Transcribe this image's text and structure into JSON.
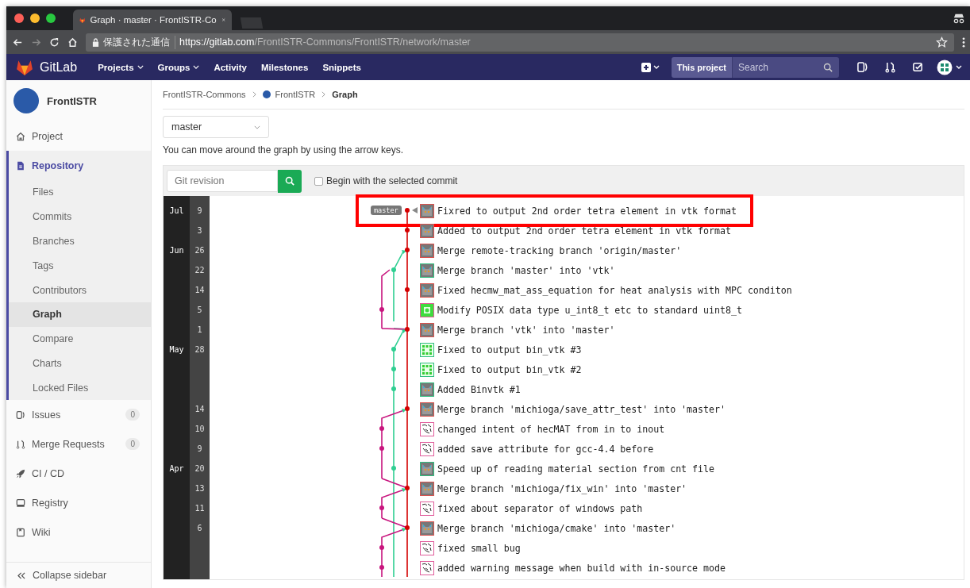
{
  "browser": {
    "tab_title": "Graph · master · FrontISTR-Co",
    "security_label": "保護された通信",
    "url_host": "https://gitlab.com",
    "url_path": "/FrontISTR-Commons/FrontISTR/network/master"
  },
  "nav": {
    "brand": "GitLab",
    "items": [
      {
        "label": "Projects",
        "dropdown": true
      },
      {
        "label": "Groups",
        "dropdown": true
      },
      {
        "label": "Activity",
        "dropdown": false
      },
      {
        "label": "Milestones",
        "dropdown": false
      },
      {
        "label": "Snippets",
        "dropdown": false
      }
    ],
    "scope_label": "This project",
    "search_placeholder": "Search"
  },
  "sidebar": {
    "project_name": "FrontISTR",
    "items": [
      {
        "label": "Project",
        "selected": false
      },
      {
        "label": "Repository",
        "selected": true,
        "children": [
          {
            "label": "Files",
            "selected": false
          },
          {
            "label": "Commits",
            "selected": false
          },
          {
            "label": "Branches",
            "selected": false
          },
          {
            "label": "Tags",
            "selected": false
          },
          {
            "label": "Contributors",
            "selected": false
          },
          {
            "label": "Graph",
            "selected": true
          },
          {
            "label": "Compare",
            "selected": false
          },
          {
            "label": "Charts",
            "selected": false
          },
          {
            "label": "Locked Files",
            "selected": false
          }
        ]
      },
      {
        "label": "Issues",
        "selected": false,
        "badge": "0"
      },
      {
        "label": "Merge Requests",
        "selected": false,
        "badge": "0"
      },
      {
        "label": "CI / CD",
        "selected": false
      },
      {
        "label": "Registry",
        "selected": false
      },
      {
        "label": "Wiki",
        "selected": false
      }
    ],
    "collapse_label": "Collapse sidebar"
  },
  "breadcrumbs": [
    "FrontISTR-Commons",
    "FrontISTR",
    "Graph"
  ],
  "branch_select": "master",
  "hint": "You can move around the graph by using the arrow keys.",
  "revision": {
    "placeholder": "Git revision",
    "begin_label": "Begin with the selected commit",
    "checked": false
  },
  "commits": [
    {
      "month": "Jul",
      "day": "9",
      "message": "Fixred to output 2nd order tetra element in vtk format",
      "kind": "cat",
      "color": "#d9534f",
      "ref": "master",
      "highlighted": true
    },
    {
      "day": "3",
      "message": "Added to output 2nd order tetra element in vtk format",
      "kind": "cat",
      "color": "#d9534f",
      "highlighted": false
    },
    {
      "month": "Jun",
      "day": "26",
      "message": "Merge remote-tracking branch 'origin/master'",
      "kind": "cat",
      "color": "#d9534f",
      "highlighted": false
    },
    {
      "day": "22",
      "message": "Merge branch 'master' into 'vtk'",
      "kind": "cat",
      "color": "#2fbf7f",
      "highlighted": false
    },
    {
      "day": "14",
      "message": "Fixed hecmw_mat_ass_equation for heat analysis with MPC conditon",
      "kind": "cat",
      "color": "#d9534f",
      "highlighted": false
    },
    {
      "day": "5",
      "message": "Modify POSIX data type u_int8_t etc to standard uint8_t",
      "kind": "identicon",
      "color": "#e05d9b",
      "highlighted": false
    },
    {
      "day": "1",
      "message": "Merge branch 'vtk' into 'master'",
      "kind": "cat",
      "color": "#d9534f",
      "highlighted": false
    },
    {
      "month": "May",
      "day": "28",
      "message": "Fixed to output bin_vtk #3",
      "kind": "grid",
      "color": "#2fbf7f",
      "highlighted": false
    },
    {
      "message": "Fixed to output bin_vtk #2",
      "kind": "grid",
      "color": "#2fbf7f",
      "highlighted": false
    },
    {
      "message": "Added Binvtk #1",
      "kind": "cat",
      "color": "#2fbf7f",
      "highlighted": false
    },
    {
      "day": "14",
      "message": "Merge branch 'michioga/save_attr_test' into 'master'",
      "kind": "cat",
      "color": "#d9534f",
      "highlighted": false
    },
    {
      "day": "10",
      "message": "changed intent of hecMAT from in to inout",
      "kind": "sketch",
      "color": "#e05d9b",
      "highlighted": false
    },
    {
      "day": "9",
      "message": "added save attribute for gcc-4.4 before",
      "kind": "sketch",
      "color": "#e05d9b",
      "highlighted": false
    },
    {
      "month": "Apr",
      "day": "20",
      "message": "Speed up of reading material section from cnt file",
      "kind": "cat",
      "color": "#2fbf7f",
      "highlighted": false
    },
    {
      "day": "13",
      "message": "Merge branch 'michioga/fix_win' into 'master'",
      "kind": "cat",
      "color": "#d9534f",
      "highlighted": false
    },
    {
      "day": "11",
      "message": "fixed about separator of windows path",
      "kind": "sketch",
      "color": "#e05d9b",
      "highlighted": false
    },
    {
      "day": "6",
      "message": "Merge branch 'michioga/cmake' into 'master'",
      "kind": "cat",
      "color": "#d9534f",
      "highlighted": false
    },
    {
      "message": "fixed small bug",
      "kind": "sketch",
      "color": "#e05d9b",
      "highlighted": false
    },
    {
      "message": "added warning message when build with in-source mode",
      "kind": "sketch",
      "color": "#e05d9b",
      "highlighted": false
    }
  ]
}
